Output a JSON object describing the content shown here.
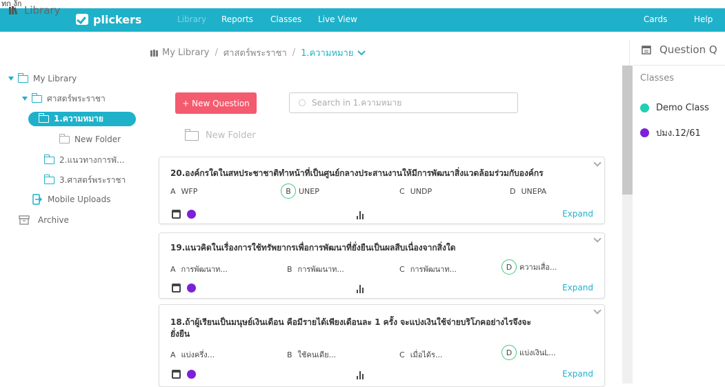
{
  "topstrip": {
    "fragment": "ทก งัก"
  },
  "navbar": {
    "logo": "plickers",
    "links": [
      "Library",
      "Reports",
      "Classes",
      "Live View"
    ],
    "right_links": [
      "Cards",
      "Help"
    ],
    "color": "#1fb1ca"
  },
  "sidebar": {
    "title": "Library",
    "items": [
      {
        "label": "My Library"
      },
      {
        "label": "ศาสตร์พระราชา"
      },
      {
        "label": "1.ความหมาย"
      },
      {
        "label": "New Folder"
      },
      {
        "label": "2.แนวทางการพั..."
      },
      {
        "label": "3.ศาสตร์พระราชา"
      },
      {
        "label": "Mobile Uploads"
      },
      {
        "label": "Archive"
      }
    ]
  },
  "breadcrumb": {
    "root": "My Library",
    "parent": "ศาสตร์พระราชา",
    "current": "1.ความหมาย"
  },
  "toolbar": {
    "new_question": "+ New Question",
    "search_placeholder": "Search in 1.ความหมาย",
    "new_folder": "New Folder"
  },
  "questions": [
    {
      "text": "20.องค์กรใดในสหประชาชาติทำหน้าที่เป็นศูนย์กลางประสานงานให้มีการพัฒนาสิ่งแวดล้อมร่วมกับองค์กร",
      "options": [
        {
          "letter": "A",
          "text": "WFP"
        },
        {
          "letter": "B",
          "text": "UNEP"
        },
        {
          "letter": "C",
          "text": "UNDP"
        },
        {
          "letter": "D",
          "text": "UNEPA"
        }
      ],
      "correct": "B",
      "expand": "Expand"
    },
    {
      "text": "19.แนวคิดในเรื่องการใช้ทรัพยากรเพื่อการพัฒนาที่ยั่งยืนเป็นผลสืบเนื่องจากสิ่งใด",
      "options": [
        {
          "letter": "A",
          "text": "การพัฒนาท..."
        },
        {
          "letter": "B",
          "text": "การพัฒนาท..."
        },
        {
          "letter": "C",
          "text": "การพัฒนาท..."
        },
        {
          "letter": "D",
          "text": "ความเสื่อ..."
        }
      ],
      "correct": "D",
      "expand": "Expand"
    },
    {
      "text": "18.ถ้าผู้เรียนเป็นมนุษย์เงินเดือน คือมีรายได้เพียงเดือนละ 1 ครั้ง จะแบ่งเงินใช้จ่ายบริโภคอย่างไรจึงจะ",
      "text2": "ยั่งยืน",
      "options": [
        {
          "letter": "A",
          "text": "แบ่งครึ่ง..."
        },
        {
          "letter": "B",
          "text": "ใช้คนเดีย..."
        },
        {
          "letter": "C",
          "text": "เมื่อได้ร..."
        },
        {
          "letter": "D",
          "text": "แบ่งเงินL..."
        }
      ],
      "correct": "D",
      "expand": "Expand"
    }
  ],
  "right_panel": {
    "title": "Question Q",
    "classes_label": "Classes",
    "classes": [
      {
        "name": "Demo Class",
        "color": "#1fcfb4"
      },
      {
        "name": "ปมง.12/61",
        "color": "#7c21d9"
      }
    ]
  }
}
